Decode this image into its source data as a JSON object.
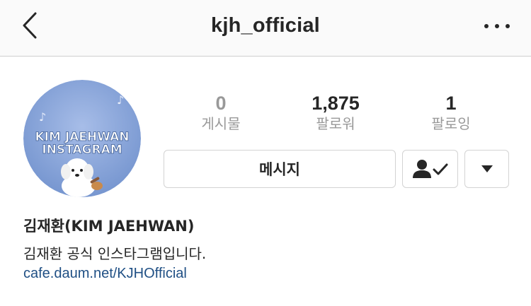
{
  "header": {
    "username": "kjh_official",
    "back_icon": "chevron-left-icon",
    "more_icon": "more-horizontal-icon"
  },
  "profile": {
    "avatar_text_line1": "KIM JAEHWAN",
    "avatar_text_line2": "INSTAGRAM",
    "avatar_bg": "#7e9fd6"
  },
  "stats": {
    "posts": {
      "value": "0",
      "label": "게시물"
    },
    "followers": {
      "value": "1,875",
      "label": "팔로워"
    },
    "following": {
      "value": "1",
      "label": "팔로잉"
    }
  },
  "actions": {
    "message_label": "메시지",
    "follow_icon": "person-check-icon",
    "dropdown_icon": "triangle-down-icon"
  },
  "bio": {
    "name": "김재환(KIM JAEHWAN)",
    "text": "김재환 공식 인스타그램입니다.",
    "link": "cafe.daum.net/KJHOfficial"
  }
}
